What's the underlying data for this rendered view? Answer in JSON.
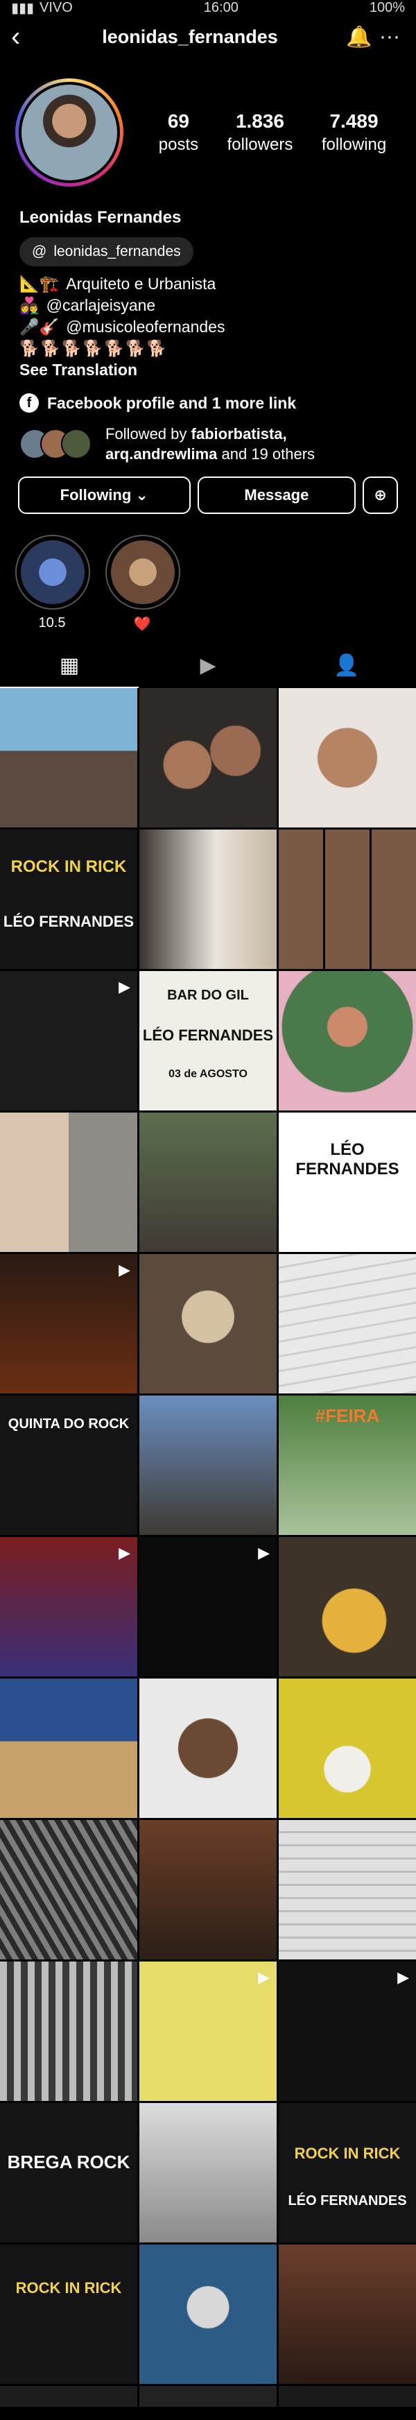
{
  "status": {
    "carrier": "VIVO",
    "time": "16:00",
    "battery": "100%"
  },
  "header": {
    "username": "leonidas_fernandes"
  },
  "stats": [
    {
      "num": "69",
      "label": "posts"
    },
    {
      "num": "1.836",
      "label": "followers"
    },
    {
      "num": "7.489",
      "label": "following"
    }
  ],
  "profile": {
    "name": "Leonidas Fernandes",
    "thread_handle": "leonidas_fernandes",
    "bio": [
      {
        "emoji": "📐🏗️",
        "text": "Arquiteto e Urbanista"
      },
      {
        "emoji": "👩‍❤️‍👨",
        "text": "@carlajeisyane"
      },
      {
        "emoji": "🎤🎸",
        "text": "@musicoleofernandes"
      }
    ],
    "bio_emoji_line": "🐕🐕🐕🐕🐕🐕🐕",
    "see_translation": "See Translation",
    "links": "Facebook profile and 1 more link",
    "followed_prefix": "Followed by ",
    "followed_names": "fabiorbatista, arq.andrewlima",
    "followed_suffix": " and 19 others"
  },
  "buttons": {
    "following": "Following ⌄",
    "message": "Message",
    "add": "⊕"
  },
  "highlights": [
    {
      "label": "10.5",
      "bg": "#2b3b60"
    },
    {
      "label": "❤️",
      "bg": "#6b4a38"
    }
  ],
  "grid_texts": {
    "rock_rick": "ROCK IN RICK",
    "leo_fernandes": "LÉO FERNANDES",
    "bar_do_gil": "BAR DO GIL",
    "date": "03 de AGOSTO",
    "quinta": "QUINTA DO ROCK",
    "feira": "#FEIRA",
    "brega": "BREGA ROCK"
  }
}
